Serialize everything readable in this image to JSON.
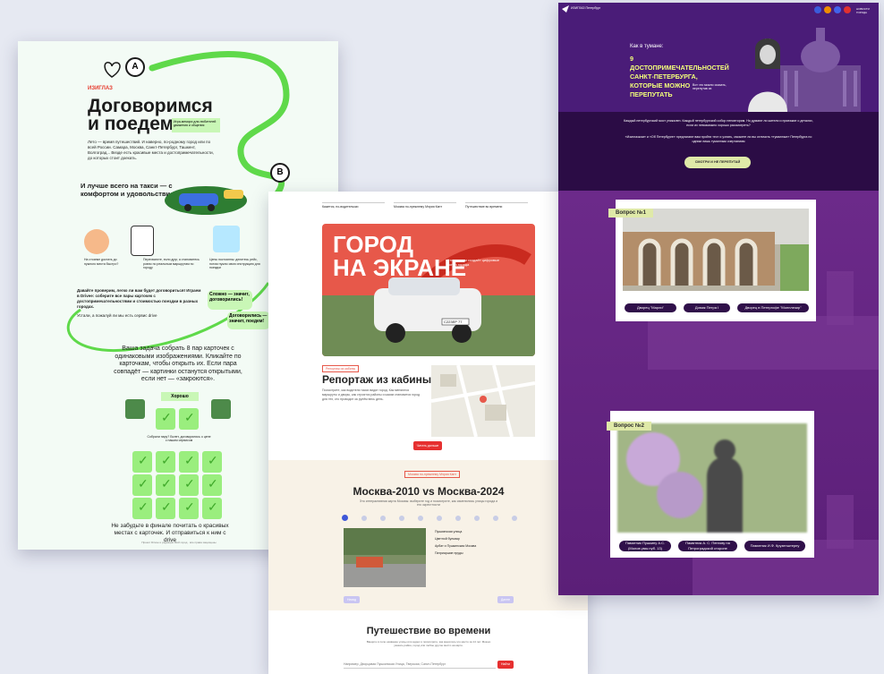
{
  "left": {
    "brand": "ИЗИГЛАЗ",
    "title_line1": "Договоримся",
    "title_line2": "и поедем",
    "title_badge": "Игра-мемори для любителей движения и общения",
    "pin_a": "A",
    "pin_b": "B",
    "intro": "Лето — время путешествий. И наверно, по-родному город или по всей России. Самара, Москва, Санкт-Петербург, Ташкент, Волгоград... Везде есть красивые места и достопримечательности, до которых стоит доехать.",
    "taxi_heading": "И лучше всего на такси — с комфортом и удовольствием",
    "features": [
      "На стоянке достать до нужного места быстро?",
      "Перехватите, если друг, а становитесь ровно по реальным маршрутам по городу",
      "Цены постоянны: делитесь рейс, потом нужно свою инструкцию для поездки"
    ],
    "speech": "Давайте проверим, легко ли вам будет договориться! Играем в Drivee: соберите все пары карточек с достопримечательностями и стоимостью поездки в разных городах.",
    "speech_sub": "Устали, а пожалуй ли мы есть сервис drive",
    "sticker1": "Сложно — значит, договорились!",
    "sticker2": "Договорились — значит, поедем!",
    "task": "Ваша задача собрать 8 пар карточек с одинаковыми изображениями. Кликайте по карточкам, чтобы открыть их. Если пара совпадёт — картинки останутся открытыми, если нет — «закроются».",
    "good_label": "Хорошо",
    "collected": "Собрали пару? Билет, договорились о цене с нашим сервисом",
    "footer": "Не забудьте в финале почитать о красивых местах с карточек. И отправиться к ним с drive",
    "fine": "Проект Drivee и редакция Мой город · все права защищены"
  },
  "middle": {
    "nav": [
      "Кажется, по-водительски",
      "Москва по-прежнему Мэрия Кант",
      "Путешествие во времени"
    ],
    "hero_title_line1": "ГОРОД",
    "hero_title_line2": "НА ЭКРАНЕ",
    "hero_sub": "Кто и зачем создаёт цифровые копии города",
    "hero_plate": "С223ЕР 77",
    "section_tag": "Репортаж из кабины",
    "report_title": "Репортаж из кабины",
    "report_text": "Посмотрите, как водители такси видят город. Как меняются маршруты и дворы, как строятся районы и каким становится город для тех, кто проводит за рулём весь день.",
    "report_button": "Читать дальше",
    "compare_tag": "Москва по-прежнему Мэрия Кант",
    "compare_title": "Москва-2010 vs Москва-2024",
    "compare_sub": "Это интерактивная карта Москвы: выберите год и посмотрите, как изменились улицы города и его окрестности",
    "options": [
      "Пушкинская улица",
      "Цветной бульвар",
      "Арбат и Пушкинская Москва",
      "Патриаршие пруды"
    ],
    "prev": "Назад",
    "next": "Далее",
    "time_title": "Путешествие во времени",
    "time_text": "Введите в поле название улицы или адрес и посмотрите, как менялось это место за 14 лет. Можно указать район, город или любое другое место на карте.",
    "search_placeholder": "Например, Дворцовая Пушкинская Улица, Тверская, Санкт-Петербург",
    "search_button": "Найти"
  },
  "right": {
    "logo": "ИЗИГЛАЗ Петербург",
    "nav_link": "НОВОСТИ ГОРОДА",
    "hero_kicker": "Как в тумане:",
    "hero_title": "9 ДОСТОПРИМЕЧАТЕЛЬНОСТЕЙ САНКТ-ПЕТЕРБУРГА, КОТОРЫЕ МОЖНО ПЕРЕПУТАТЬ",
    "hero_hint": "Вот что можно сказать, перепутав их",
    "intro1": "Каждый петербургский мост уникален. Каждый петербургский собор неповторим. Но думают ли жители и приезжие о деталях, если их невозможно хорошо рассмотреть?",
    "intro2": "«Изиглазком» и «Об Петербурге» предлагают вам пройти тест и узнать, сможете ли вы отличить «туманные» Петербурга по одним лишь туманным очертаниям",
    "cta": "СМОТРИ И НЕ ПЕРЕПУТАЙ",
    "q1_tag": "Вопрос №1",
    "q1_answers": [
      "Дворец \"Марли\"",
      "Домик Петра I",
      "Дворец в Петергофе \"Монплезир\""
    ],
    "q2_tag": "Вопрос №2",
    "q2_answers": [
      "Памятник Пушкину А.С. (Молов умы пуб. 13)",
      "Памятник А. С. Пенгову на Петроградской стороне",
      "Памятник И.Ф. Крузенштерну"
    ]
  },
  "colors": {
    "page_bg": "#e6e9f2",
    "left_bg": "#f3fbf5",
    "left_accent": "#5fd94a",
    "mid_red": "#e7584a",
    "right_bg": "#3c155a",
    "right_tag": "#dfe9a8"
  }
}
